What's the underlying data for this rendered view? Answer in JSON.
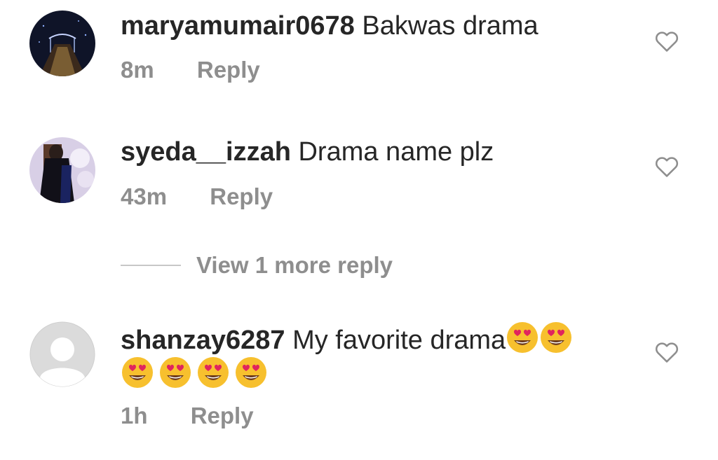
{
  "comments": [
    {
      "username": "maryamumair0678",
      "text": "Bakwas drama",
      "time": "8m",
      "reply_label": "Reply",
      "avatar": "night-bridge-photo"
    },
    {
      "username": "syeda__izzah",
      "text": "Drama name plz",
      "time": "43m",
      "reply_label": "Reply",
      "avatar": "person-photo"
    },
    {
      "username": "shanzay6287",
      "text": "My favorite drama",
      "time": "1h",
      "reply_label": "Reply",
      "avatar": "default-user-placeholder",
      "emoji_count": 6,
      "emoji": "heart-eyes-emoji"
    }
  ],
  "view_more": {
    "label": "View 1 more reply"
  },
  "icons": {
    "like": "heart-outline-icon"
  },
  "colors": {
    "text": "#262626",
    "secondary": "#8e8e8e",
    "emoji": "#f7c02e",
    "heart_red": "#e0245e"
  }
}
